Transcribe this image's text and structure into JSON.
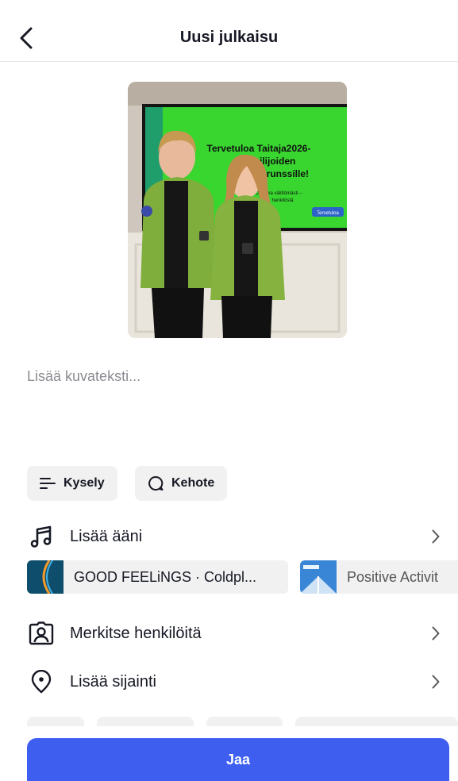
{
  "header": {
    "title": "Uusi julkaisu"
  },
  "photo": {
    "screen_lines": [
      "Tervetuloa Taitaja2026-",
      "kilpailijoiden",
      "aamu-brunssille!"
    ],
    "screen_small": [
      "Ohjelma välittömästi –",
      "henkilöstä"
    ],
    "screen_badge": "Tervetuloa"
  },
  "caption": {
    "placeholder": "Lisää kuvateksti..."
  },
  "chips": [
    {
      "label": "Kysely",
      "icon": "poll-icon"
    },
    {
      "label": "Kehote",
      "icon": "prompt-icon"
    }
  ],
  "add_sound": {
    "label": "Lisää ääni"
  },
  "music": [
    {
      "title": "GOOD FEELiNGS · Coldpl..."
    },
    {
      "title": "Positive Activit"
    }
  ],
  "tag_people": {
    "label": "Merkitse henkilöitä"
  },
  "add_location": {
    "label": "Lisää sijainti"
  },
  "share": {
    "label": "Jaa"
  },
  "colors": {
    "accent": "#3e5ef0",
    "chip_bg": "#f1f1f2",
    "text": "#161823",
    "muted": "#8a8b91"
  }
}
